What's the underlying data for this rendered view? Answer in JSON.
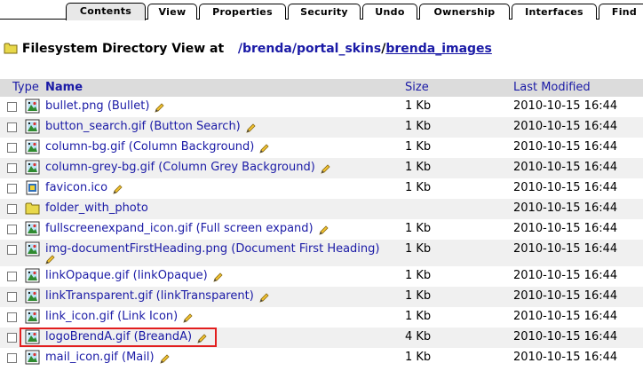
{
  "tabs": [
    "Contents",
    "View",
    "Properties",
    "Security",
    "Undo",
    "Ownership",
    "Interfaces",
    "Find"
  ],
  "heading": {
    "prefix": "Filesystem Directory View at",
    "path_parts": [
      "/brenda",
      "/portal_skins",
      "/",
      "brenda_images"
    ]
  },
  "table": {
    "columns": {
      "type": "Type",
      "name": "Name",
      "size": "Size",
      "modified": "Last Modified"
    },
    "rows": [
      {
        "name": "bullet.png (Bullet)",
        "size": "1 Kb",
        "modified": "2010-10-15 16:44",
        "icon": "image-icon"
      },
      {
        "name": "button_search.gif (Button Search)",
        "size": "1 Kb",
        "modified": "2010-10-15 16:44",
        "icon": "image-icon"
      },
      {
        "name": "column-bg.gif (Column Background)",
        "size": "1 Kb",
        "modified": "2010-10-15 16:44",
        "icon": "image-icon"
      },
      {
        "name": "column-grey-bg.gif (Column Grey Background)",
        "size": "1 Kb",
        "modified": "2010-10-15 16:44",
        "icon": "image-icon"
      },
      {
        "name": "favicon.ico",
        "size": "1 Kb",
        "modified": "2010-10-15 16:44",
        "icon": "file-icon"
      },
      {
        "name": "folder_with_photo",
        "size": "",
        "modified": "2010-10-15 16:44",
        "icon": "folder-icon"
      },
      {
        "name": "fullscreenexpand_icon.gif (Full screen expand)",
        "size": "1 Kb",
        "modified": "2010-10-15 16:44",
        "icon": "image-icon"
      },
      {
        "name": "img-documentFirstHeading.png (Document First Heading)",
        "size": "1 Kb",
        "modified": "2010-10-15 16:44",
        "icon": "image-icon"
      },
      {
        "name": "linkOpaque.gif (linkOpaque)",
        "size": "1 Kb",
        "modified": "2010-10-15 16:44",
        "icon": "image-icon"
      },
      {
        "name": "linkTransparent.gif (linkTransparent)",
        "size": "1 Kb",
        "modified": "2010-10-15 16:44",
        "icon": "image-icon"
      },
      {
        "name": "link_icon.gif (Link Icon)",
        "size": "1 Kb",
        "modified": "2010-10-15 16:44",
        "icon": "image-icon"
      },
      {
        "name": "logoBrendA.gif (BreandA)",
        "size": "4 Kb",
        "modified": "2010-10-15 16:44",
        "icon": "image-icon"
      },
      {
        "name": "mail_icon.gif (Mail)",
        "size": "1 Kb",
        "modified": "2010-10-15 16:44",
        "icon": "image-icon"
      }
    ]
  }
}
